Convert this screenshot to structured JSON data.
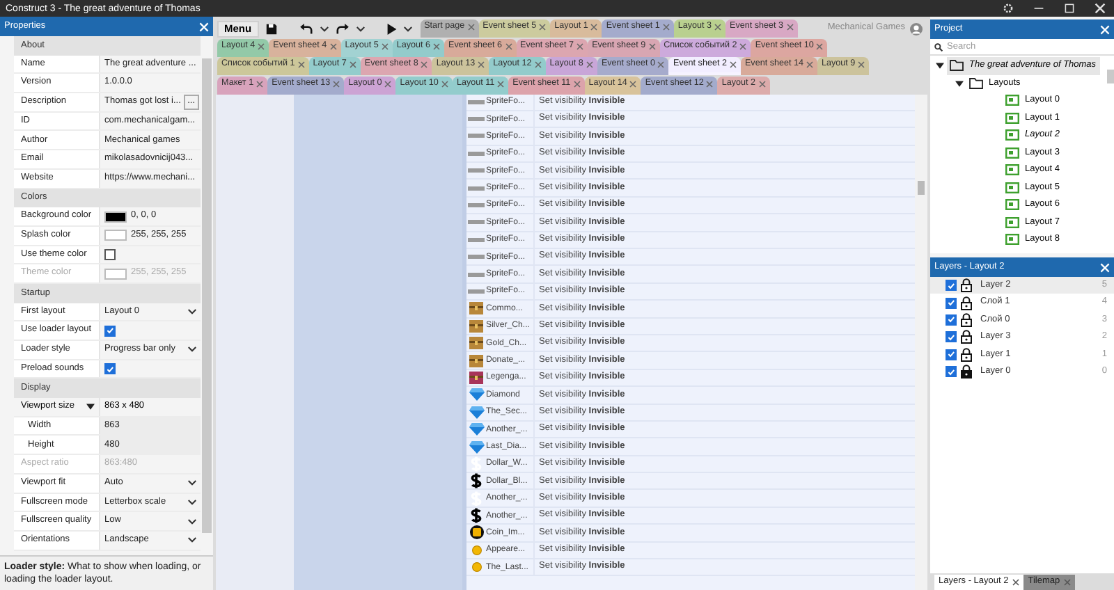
{
  "window": {
    "title": "Construct 3 - The great adventure of Thomas"
  },
  "properties": {
    "title": "Properties",
    "rows": [
      {
        "kind": "section",
        "label": "About"
      },
      {
        "kind": "text",
        "label": "Name",
        "value": "The great adventure ..."
      },
      {
        "kind": "text",
        "label": "Version",
        "value": "1.0.0.0"
      },
      {
        "kind": "button",
        "label": "Description",
        "value": "Thomas got lost i...",
        "button": "..."
      },
      {
        "kind": "text",
        "label": "ID",
        "value": "com.mechanicalgam..."
      },
      {
        "kind": "text",
        "label": "Author",
        "value": "Mechanical games"
      },
      {
        "kind": "text",
        "label": "Email",
        "value": "mikolasadovnicij043..."
      },
      {
        "kind": "text",
        "label": "Website",
        "value": "https://www.mechani..."
      },
      {
        "kind": "section",
        "label": "Colors"
      },
      {
        "kind": "color",
        "label": "Background color",
        "color": "#000000",
        "value": "0, 0, 0",
        "disabled": false
      },
      {
        "kind": "color",
        "label": "Splash color",
        "color": "#ffffff",
        "value": "255, 255, 255",
        "disabled": false
      },
      {
        "kind": "checkbox",
        "label": "Use theme color",
        "checked": false
      },
      {
        "kind": "color",
        "label": "Theme color",
        "color": "#ffffff",
        "value": "255, 255, 255",
        "disabled": true
      },
      {
        "kind": "section",
        "label": "Startup"
      },
      {
        "kind": "dropdown",
        "label": "First layout",
        "value": "Layout 0"
      },
      {
        "kind": "checkbox",
        "label": "Use loader layout",
        "checked": true
      },
      {
        "kind": "dropdown",
        "label": "Loader style",
        "value": "Progress bar only"
      },
      {
        "kind": "checkbox",
        "label": "Preload sounds",
        "checked": true
      },
      {
        "kind": "section",
        "label": "Display"
      },
      {
        "kind": "group",
        "label": "Viewport size",
        "value": "863 x 480",
        "expanded": true
      },
      {
        "kind": "sub",
        "label": "Width",
        "value": "863"
      },
      {
        "kind": "sub",
        "label": "Height",
        "value": "480"
      },
      {
        "kind": "disabled",
        "label": "Aspect ratio",
        "value": "863:480"
      },
      {
        "kind": "dropdown",
        "label": "Viewport fit",
        "value": "Auto"
      },
      {
        "kind": "dropdown",
        "label": "Fullscreen mode",
        "value": "Letterbox scale"
      },
      {
        "kind": "dropdown",
        "label": "Fullscreen quality",
        "value": "Low"
      },
      {
        "kind": "dropdown",
        "label": "Orientations",
        "value": "Landscape"
      }
    ],
    "help": "**Loader style:** What to show when loading, or loading the loader layout."
  },
  "toolbar": {
    "menu": "Menu",
    "account": "Mechanical Games"
  },
  "tab_rows": [
    {
      "tabs": [
        {
          "label": "Start page",
          "color": "#b0b0b0",
          "selected": false
        },
        {
          "label": "Event sheet 5",
          "color": "#cccb9e",
          "selected": false
        },
        {
          "label": "Layout 1",
          "color": "#d8bb9c",
          "selected": false
        },
        {
          "label": "Event sheet 1",
          "color": "#a4abcc",
          "selected": false
        },
        {
          "label": "Layout 3",
          "color": "#b9d08f",
          "selected": false
        },
        {
          "label": "Event sheet 3",
          "color": "#d8a8c4",
          "selected": false
        }
      ]
    },
    {
      "tabs": [
        {
          "label": "Layout 4",
          "color": "#93c9a8",
          "selected": false
        },
        {
          "label": "Event sheet 4",
          "color": "#d8b29c",
          "selected": false
        },
        {
          "label": "Layout 5",
          "color": "#a2d2d2",
          "selected": false
        },
        {
          "label": "Layout 6",
          "color": "#93cbcb",
          "selected": false
        },
        {
          "label": "Event sheet 6",
          "color": "#d8aa9a",
          "selected": false
        },
        {
          "label": "Event sheet 7",
          "color": "#dca6b0",
          "selected": false
        },
        {
          "label": "Event sheet 9",
          "color": "#d8a6b2",
          "selected": false
        },
        {
          "label": "Список событий 2",
          "color": "#cdaadc",
          "selected": false
        },
        {
          "label": "Event sheet 10",
          "color": "#dca6a0",
          "selected": false
        }
      ]
    },
    {
      "tabs": [
        {
          "label": "Список событий 1",
          "color": "#ccc79a",
          "selected": false
        },
        {
          "label": "Layout 7",
          "color": "#93cccc",
          "selected": false
        },
        {
          "label": "Event sheet 8",
          "color": "#dca6b0",
          "selected": false
        },
        {
          "label": "Layout 13",
          "color": "#ccc39c",
          "selected": false
        },
        {
          "label": "Layout 12",
          "color": "#93cbcb",
          "selected": false
        },
        {
          "label": "Layout 8",
          "color": "#c8a6d8",
          "selected": false
        },
        {
          "label": "Event sheet 0",
          "color": "#a6abcc",
          "selected": false
        },
        {
          "label": "Event sheet 2",
          "color": "#f2eeff",
          "selected": true
        },
        {
          "label": "Event sheet 14",
          "color": "#d8aa9a",
          "selected": false
        },
        {
          "label": "Layout 9",
          "color": "#ccc39c",
          "selected": false
        }
      ]
    },
    {
      "tabs": [
        {
          "label": "Макет 1",
          "color": "#d8a3bc",
          "selected": false
        },
        {
          "label": "Event sheet 13",
          "color": "#a3abcc",
          "selected": false
        },
        {
          "label": "Layout 0",
          "color": "#cca3d4",
          "selected": false
        },
        {
          "label": "Layout 10",
          "color": "#93cccc",
          "selected": false
        },
        {
          "label": "Layout 11",
          "color": "#93cccc",
          "selected": false
        },
        {
          "label": "Event sheet 11",
          "color": "#dca3ab",
          "selected": false
        },
        {
          "label": "Layout 14",
          "color": "#d8c39b",
          "selected": false
        },
        {
          "label": "Event sheet 12",
          "color": "#a3abcc",
          "selected": false
        },
        {
          "label": "Layout 2",
          "color": "#dcabab",
          "selected": false
        }
      ]
    }
  ],
  "actions": [
    {
      "kind": "spritefont",
      "object": "SpriteFo...",
      "action": "Set visibility **Invisible**"
    },
    {
      "kind": "spritefont",
      "object": "SpriteFo...",
      "action": "Set visibility **Invisible**"
    },
    {
      "kind": "spritefont",
      "object": "SpriteFo...",
      "action": "Set visibility **Invisible**"
    },
    {
      "kind": "spritefont",
      "object": "SpriteFo...",
      "action": "Set visibility **Invisible**"
    },
    {
      "kind": "spritefont",
      "object": "SpriteFo...",
      "action": "Set visibility **Invisible**"
    },
    {
      "kind": "spritefont",
      "object": "SpriteFo...",
      "action": "Set visibility **Invisible**"
    },
    {
      "kind": "spritefont",
      "object": "SpriteFo...",
      "action": "Set visibility **Invisible**"
    },
    {
      "kind": "spritefont",
      "object": "SpriteFo...",
      "action": "Set visibility **Invisible**"
    },
    {
      "kind": "spritefont",
      "object": "SpriteFo...",
      "action": "Set visibility **Invisible**"
    },
    {
      "kind": "spritefont",
      "object": "SpriteFo...",
      "action": "Set visibility **Invisible**"
    },
    {
      "kind": "spritefont",
      "object": "SpriteFo...",
      "action": "Set visibility **Invisible**"
    },
    {
      "kind": "spritefont",
      "object": "SpriteFo...",
      "action": "Set visibility **Invisible**"
    },
    {
      "kind": "chest",
      "object": "Commo...",
      "action": "Set visibility **Invisible**"
    },
    {
      "kind": "chest",
      "object": "Silver_Ch...",
      "action": "Set visibility **Invisible**"
    },
    {
      "kind": "chest",
      "object": "Gold_Ch...",
      "action": "Set visibility **Invisible**"
    },
    {
      "kind": "chest",
      "object": "Donate_...",
      "action": "Set visibility **Invisible**"
    },
    {
      "kind": "redchest",
      "object": "Legenga...",
      "action": "Set visibility **Invisible**"
    },
    {
      "kind": "diamond",
      "object": "Diamond",
      "action": "Set visibility **Invisible**"
    },
    {
      "kind": "diamond",
      "object": "The_Sec...",
      "action": "Set visibility **Invisible**"
    },
    {
      "kind": "diamond",
      "object": "Another_...",
      "action": "Set visibility **Invisible**"
    },
    {
      "kind": "diamond",
      "object": "Last_Dia...",
      "action": "Set visibility **Invisible**"
    },
    {
      "kind": "dollar_white",
      "object": "Dollar_W...",
      "action": "Set visibility **Invisible**"
    },
    {
      "kind": "dollar_black",
      "object": "Dollar_Bl...",
      "action": "Set visibility **Invisible**"
    },
    {
      "kind": "dollar_white",
      "object": "Another_...",
      "action": "Set visibility **Invisible**"
    },
    {
      "kind": "dollar_black",
      "object": "Another_...",
      "action": "Set visibility **Invisible**"
    },
    {
      "kind": "coin_big",
      "object": "Coin_Im...",
      "action": "Set visibility **Invisible**"
    },
    {
      "kind": "coin_small",
      "object": "Appeare...",
      "action": "Set visibility **Invisible**"
    },
    {
      "kind": "coin_small",
      "object": "The_Last...",
      "action": "Set visibility **Invisible**"
    }
  ],
  "project": {
    "title": "Project",
    "search": {
      "placeholder": "Search"
    },
    "tree": [
      {
        "kind": "project",
        "label": "The great adventure of Thomas",
        "selected": true,
        "expanded": true,
        "children": [
          {
            "kind": "folder",
            "label": "Layouts",
            "selected": false,
            "expanded": true,
            "children": [
              {
                "kind": "layout",
                "label": "Layout 0",
                "selected": false
              },
              {
                "kind": "layout",
                "label": "Layout 1",
                "selected": false
              },
              {
                "kind": "layout",
                "label": "Layout 2",
                "selected": false,
                "open": true
              },
              {
                "kind": "layout",
                "label": "Layout 3",
                "selected": false
              },
              {
                "kind": "layout",
                "label": "Layout 4",
                "selected": false
              },
              {
                "kind": "layout",
                "label": "Layout 5",
                "selected": false
              },
              {
                "kind": "layout",
                "label": "Layout 6",
                "selected": false
              },
              {
                "kind": "layout",
                "label": "Layout 7",
                "selected": false
              },
              {
                "kind": "layout",
                "label": "Layout 8",
                "selected": false
              }
            ]
          }
        ]
      }
    ]
  },
  "layers": {
    "title": "Layers - Layout 2",
    "rows": [
      {
        "name": "Layer 2",
        "index": "5",
        "visible": true,
        "locked": false,
        "selected": true
      },
      {
        "name": "Слой 1",
        "index": "4",
        "visible": true,
        "locked": false,
        "selected": false
      },
      {
        "name": "Слой 0",
        "index": "3",
        "visible": true,
        "locked": false,
        "selected": false
      },
      {
        "name": "Layer 3",
        "index": "2",
        "visible": true,
        "locked": false,
        "selected": false
      },
      {
        "name": "Layer 1",
        "index": "1",
        "visible": true,
        "locked": false,
        "selected": false
      },
      {
        "name": "Layer 0",
        "index": "0",
        "visible": true,
        "locked": true,
        "selected": false
      }
    ]
  },
  "bottom_tabs": [
    {
      "label": "Layers - Layout 2",
      "selected": true
    },
    {
      "label": "Tilemap",
      "selected": false
    }
  ]
}
